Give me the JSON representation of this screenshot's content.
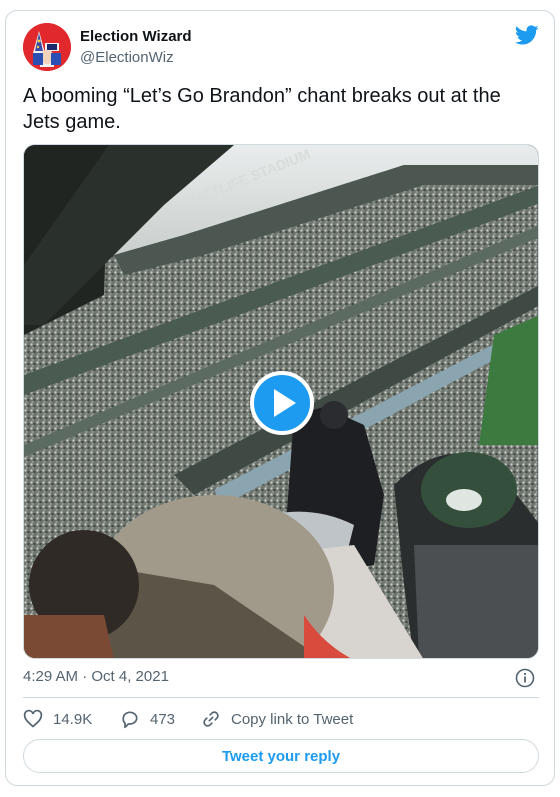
{
  "author": {
    "display_name": "Election Wizard",
    "handle": "@ElectionWiz"
  },
  "tweet": {
    "text": "A booming “Let’s Go Brandon” chant breaks out at the Jets game."
  },
  "media": {
    "type": "video",
    "stadium_sign": "METLIFE STADIUM"
  },
  "meta": {
    "timestamp": "4:29 AM · Oct 4, 2021"
  },
  "actions": {
    "likes": "14.9K",
    "replies": "473",
    "copy_link": "Copy link to Tweet"
  },
  "reply_button": "Tweet your reply",
  "colors": {
    "brand_blue": "#1d9bf0",
    "text_primary": "#0f1419",
    "text_secondary": "#536471",
    "border": "#cfd9de",
    "avatar_bg": "#e0282d"
  },
  "icons": [
    "wizard-avatar",
    "twitter-bird-icon",
    "play-icon",
    "info-icon",
    "heart-icon",
    "reply-icon",
    "link-icon"
  ]
}
